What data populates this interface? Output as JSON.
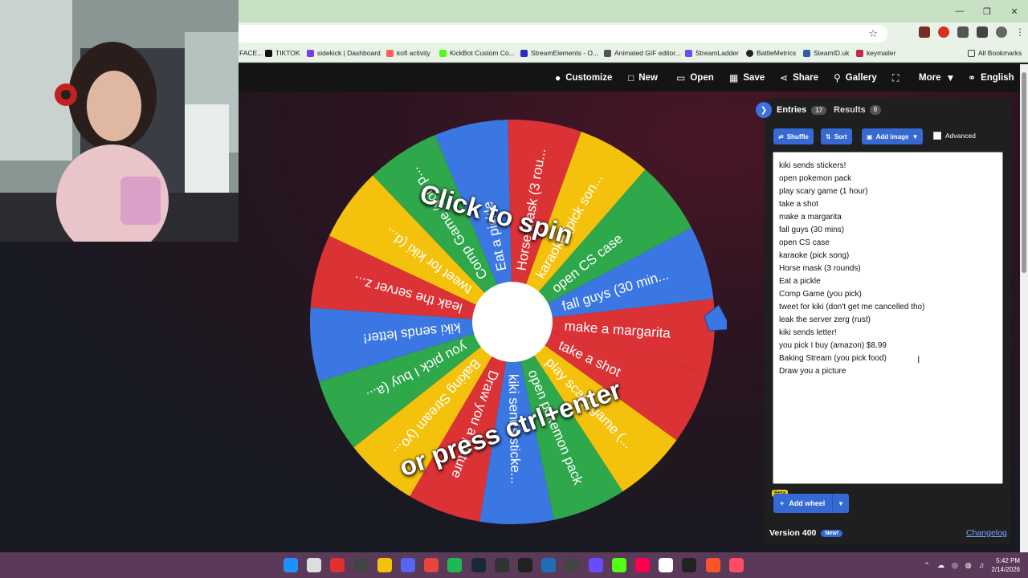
{
  "browser": {
    "bookmarks": [
      {
        "label": "FACE...",
        "color": "#3b5998"
      },
      {
        "label": "TIKTOK",
        "color": "#111111"
      },
      {
        "label": "sidekick | Dashboard",
        "color": "#7b3fe4"
      },
      {
        "label": "kofi activity",
        "color": "#ff5e5b"
      },
      {
        "label": "KickBot Custom Co...",
        "color": "#53fc18"
      },
      {
        "label": "StreamElements - O...",
        "color": "#2c2cc4"
      },
      {
        "label": "Animated GIF editor...",
        "color": "#555555"
      },
      {
        "label": "StreamLadder",
        "color": "#6c4cf0"
      },
      {
        "label": "BattleMetrics",
        "color": "#222222"
      },
      {
        "label": "SteamID.uk",
        "color": "#2e5fa8"
      },
      {
        "label": "keymailer",
        "color": "#c12a4a"
      }
    ],
    "all_bookmarks_label": "All Bookmarks"
  },
  "toolbar": {
    "customize": "Customize",
    "new": "New",
    "open": "Open",
    "save": "Save",
    "share": "Share",
    "gallery": "Gallery",
    "more": "More",
    "language": "English"
  },
  "wheel": {
    "spin_top": "Click to spin",
    "spin_bottom": "or press ctrl+enter",
    "colors": [
      "#db3236",
      "#3b77e3",
      "#2fa74b",
      "#f4c20d"
    ],
    "segments": [
      "make a margarita",
      "fall guys (30 min...",
      "open CS case",
      "karaoke (pick son...",
      "Horse mask (3 rou...",
      "Eat a pickle",
      "Comp Game (you p...",
      "tweet for kiki (d...",
      "leak the server z...",
      "kiki sends letter!",
      "you pick I buy (a...",
      "Baking Stream (yo...",
      "Draw you a picture",
      "kiki sends sticke...",
      "open pokemon pack",
      "play scary game (...",
      "take a shot"
    ]
  },
  "panel": {
    "entries_tab": "Entries",
    "entries_count": "17",
    "results_tab": "Results",
    "results_count": "0",
    "shuffle": "Shuffle",
    "sort": "Sort",
    "add_image": "Add image",
    "advanced": "Advanced",
    "entries": [
      "kiki sends stickers!",
      "open pokemon pack",
      "play scary game (1 hour)",
      "take a shot",
      "make a margarita",
      "fall guys (30 mins)",
      "open CS case",
      "karaoke (pick song)",
      "Horse mask (3 rounds)",
      "Eat a pickle",
      "Comp Game (you pick)",
      "tweet for kiki (don't get me cancelled tho)",
      "leak the server zerg (rust)",
      "kiki sends letter!",
      "you pick I buy (amazon) $8.99",
      "Baking Stream (you pick food)",
      "Draw you a picture"
    ],
    "beta": "Beta",
    "add_wheel": "Add wheel",
    "version": "Version 400",
    "new_badge": "New!",
    "changelog": "Changelog"
  },
  "taskbar": {
    "time": "5:42 PM",
    "date": "2/14/2026",
    "icons": [
      "windows-start",
      "search",
      "hud",
      "app",
      "folder",
      "discord",
      "chrome",
      "spotify",
      "steam",
      "media",
      "obs",
      "photos",
      "app",
      "app",
      "kick",
      "tiktok",
      "app",
      "app",
      "brave",
      "app"
    ]
  }
}
